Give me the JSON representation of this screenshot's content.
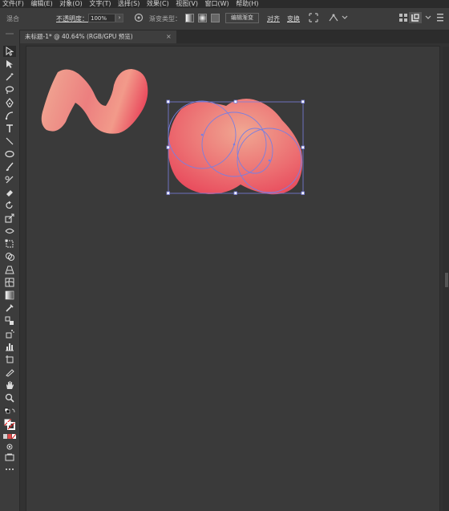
{
  "menu": [
    "文件(F)",
    "编辑(E)",
    "对象(O)",
    "文字(T)",
    "选择(S)",
    "效果(C)",
    "视图(V)",
    "窗口(W)",
    "帮助(H)"
  ],
  "control": {
    "mode_label": "混合",
    "opacity_label": "不透明度：",
    "opacity_value": "100%",
    "gradient_type_label": "渐变类型：",
    "edit_gradient": "编辑渐变",
    "align": "对齐",
    "transform": "变换"
  },
  "tab": {
    "title": "未标题-1* @ 40.64% (RGB/GPU 预览)"
  },
  "colors": {
    "accent_pink": "#e9667a",
    "accent_peach": "#f0a692",
    "selection": "#7a7fe0"
  }
}
